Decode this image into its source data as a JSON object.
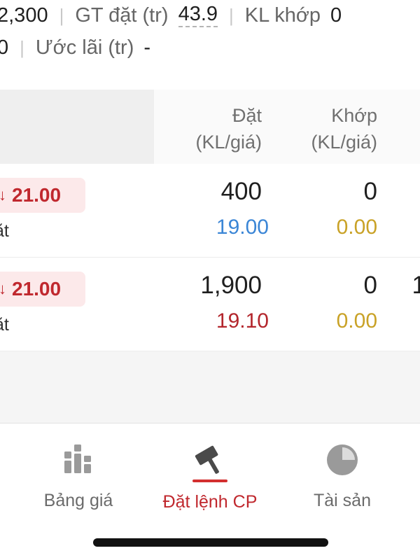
{
  "summary": {
    "line1": {
      "lead_value": "2,300",
      "gt_dat_label": "GT đặt (tr)",
      "gt_dat_value": "43.9",
      "kl_khop_label": "KL khớp",
      "kl_khop_value": "0"
    },
    "line2": {
      "lead_value": "0",
      "uoc_lai_label": "Ước lãi (tr)",
      "uoc_lai_value": "-"
    }
  },
  "table": {
    "headers": {
      "dat_line1": "Đặt",
      "dat_line2": "(KL/giá)",
      "khop_line1": "Khớp",
      "khop_line2": "(KL/giá)"
    },
    "rows": [
      {
        "price_arrow": "↓",
        "price": "21.00",
        "side": "ặt",
        "dat_qty": "400",
        "dat_price": "19.00",
        "khop_qty": "0",
        "khop_price": "0.00",
        "edge": ""
      },
      {
        "price_arrow": "↓",
        "price": "21.00",
        "side": "ặt",
        "dat_qty": "1,900",
        "dat_price": "19.10",
        "khop_qty": "0",
        "khop_price": "0.00",
        "edge": "1"
      }
    ]
  },
  "nav": {
    "items": [
      {
        "label": "Bảng giá",
        "icon": "bar-chart-icon",
        "active": false
      },
      {
        "label": "Đặt lệnh CP",
        "icon": "gavel-icon",
        "active": true
      },
      {
        "label": "Tài sản",
        "icon": "pie-chart-icon",
        "active": false
      }
    ]
  },
  "colors": {
    "accent_red": "#c0282e",
    "price_blue": "#3b86d6",
    "price_gold": "#c9a227",
    "badge_bg": "#fce9ea"
  }
}
